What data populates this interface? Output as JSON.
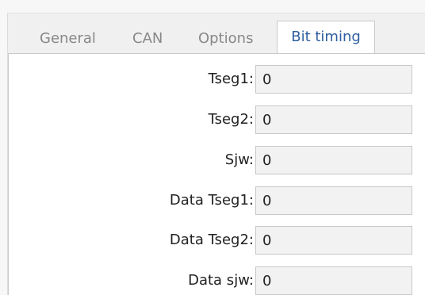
{
  "tabs": [
    {
      "label": "General",
      "active": false
    },
    {
      "label": "CAN",
      "active": false
    },
    {
      "label": "Options",
      "active": false
    },
    {
      "label": "Bit timing",
      "active": true
    }
  ],
  "fields": [
    {
      "label": "Tseg1:",
      "value": "0"
    },
    {
      "label": "Tseg2:",
      "value": "0"
    },
    {
      "label": "Sjw:",
      "value": "0"
    },
    {
      "label": "Data Tseg1:",
      "value": "0"
    },
    {
      "label": "Data Tseg2:",
      "value": "0"
    },
    {
      "label": "Data sjw:",
      "value": "0"
    }
  ],
  "colors": {
    "active_tab_text": "#2e5fa1",
    "inactive_tab_text": "#888888",
    "field_background": "#f2f2f2"
  }
}
